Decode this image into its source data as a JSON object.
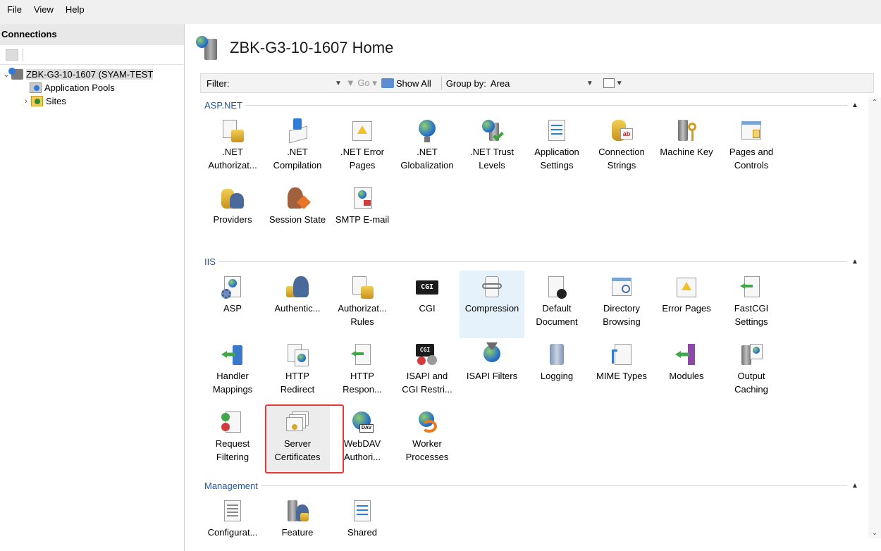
{
  "menu": {
    "file": "File",
    "view": "View",
    "help": "Help"
  },
  "connections": {
    "title": "Connections",
    "tree": {
      "server": "ZBK-G3-10-1607 (SYAM-TEST",
      "app_pools": "Application Pools",
      "sites": "Sites"
    }
  },
  "home": {
    "title": "ZBK-G3-10-1607 Home"
  },
  "filterbar": {
    "filter_label": "Filter:",
    "go_label": "Go",
    "show_all_label": "Show All",
    "group_by_label": "Group by:",
    "group_by_value": "Area"
  },
  "sections": {
    "aspnet": {
      "title": "ASP.NET",
      "items": [
        {
          "l1": ".NET",
          "l2": "Authorizat..."
        },
        {
          "l1": ".NET",
          "l2": "Compilation"
        },
        {
          "l1": ".NET Error",
          "l2": "Pages"
        },
        {
          "l1": ".NET",
          "l2": "Globalization"
        },
        {
          "l1": ".NET Trust",
          "l2": "Levels"
        },
        {
          "l1": "Application",
          "l2": "Settings"
        },
        {
          "l1": "Connection",
          "l2": "Strings"
        },
        {
          "l1": "Machine Key",
          "l2": ""
        },
        {
          "l1": "Pages and",
          "l2": "Controls"
        },
        {
          "l1": "Providers",
          "l2": ""
        },
        {
          "l1": "Session State",
          "l2": ""
        },
        {
          "l1": "SMTP E-mail",
          "l2": ""
        }
      ]
    },
    "iis": {
      "title": "IIS",
      "items": [
        {
          "l1": "ASP",
          "l2": ""
        },
        {
          "l1": "Authentic...",
          "l2": ""
        },
        {
          "l1": "Authorizat...",
          "l2": "Rules"
        },
        {
          "l1": "CGI",
          "l2": ""
        },
        {
          "l1": "Compression",
          "l2": ""
        },
        {
          "l1": "Default",
          "l2": "Document"
        },
        {
          "l1": "Directory",
          "l2": "Browsing"
        },
        {
          "l1": "Error Pages",
          "l2": ""
        },
        {
          "l1": "FastCGI",
          "l2": "Settings"
        },
        {
          "l1": "Handler",
          "l2": "Mappings"
        },
        {
          "l1": "HTTP",
          "l2": "Redirect"
        },
        {
          "l1": "HTTP",
          "l2": "Respon..."
        },
        {
          "l1": "ISAPI and",
          "l2": "CGI Restri..."
        },
        {
          "l1": "ISAPI Filters",
          "l2": ""
        },
        {
          "l1": "Logging",
          "l2": ""
        },
        {
          "l1": "MIME Types",
          "l2": ""
        },
        {
          "l1": "Modules",
          "l2": ""
        },
        {
          "l1": "Output",
          "l2": "Caching"
        },
        {
          "l1": "Request",
          "l2": "Filtering"
        },
        {
          "l1": "Server",
          "l2": "Certificates"
        },
        {
          "l1": "WebDAV",
          "l2": "Authori..."
        },
        {
          "l1": "Worker",
          "l2": "Processes"
        }
      ]
    },
    "management": {
      "title": "Management",
      "items": [
        {
          "l1": "Configurat...",
          "l2": ""
        },
        {
          "l1": "Feature",
          "l2": ""
        },
        {
          "l1": "Shared",
          "l2": ""
        }
      ]
    }
  },
  "icons": {
    "cgi_text": "CGI"
  }
}
